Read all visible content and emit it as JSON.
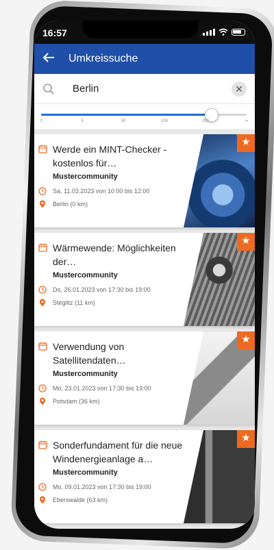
{
  "status": {
    "time": "16:57"
  },
  "appbar": {
    "title": "Umkreissuche"
  },
  "search": {
    "value": "Berlin"
  },
  "radius": {
    "ticks": [
      "0",
      "5",
      "50",
      "100",
      "200",
      "∞"
    ],
    "selected_fraction": 0.83
  },
  "events": [
    {
      "title": "Werde ein MINT-Checker - kostenlos für…",
      "community": "Mustercommunity",
      "datetime": "Sa, 11.03.2023 von 10:00 bis 12:00",
      "location": "Berlin (0 km)",
      "image_theme": "blue-machine"
    },
    {
      "title": "Wärmewende: Möglichkeiten der…",
      "community": "Mustercommunity",
      "datetime": "Do, 26.01.2023 von 17:30 bis 19:00",
      "location": "Steglitz  (11 km)",
      "image_theme": "gray-worker"
    },
    {
      "title": "Verwendung von Satellitendaten…",
      "community": "Mustercommunity",
      "datetime": "Mo, 23.01.2023 von 17:30 bis 19:00",
      "location": "Potsdam (36 km)",
      "image_theme": "light-tablet"
    },
    {
      "title": "Sonderfundament für die neue Windenergieanlage a…",
      "community": "Mustercommunity",
      "datetime": "Mo, 09.01.2023 von 17:30 bis 19:00",
      "location": "Eberswalde (63 km)",
      "image_theme": "dark-door"
    }
  ],
  "icons": {
    "back": "arrow-left-icon",
    "search": "search-icon",
    "clear": "close-icon",
    "calendar": "calendar-icon",
    "clock": "clock-icon",
    "location": "location-pin-icon",
    "favorite": "star-icon"
  },
  "colors": {
    "primary": "#1f4fa8",
    "accent": "#ee6a21",
    "slider": "#1f6fd0"
  }
}
